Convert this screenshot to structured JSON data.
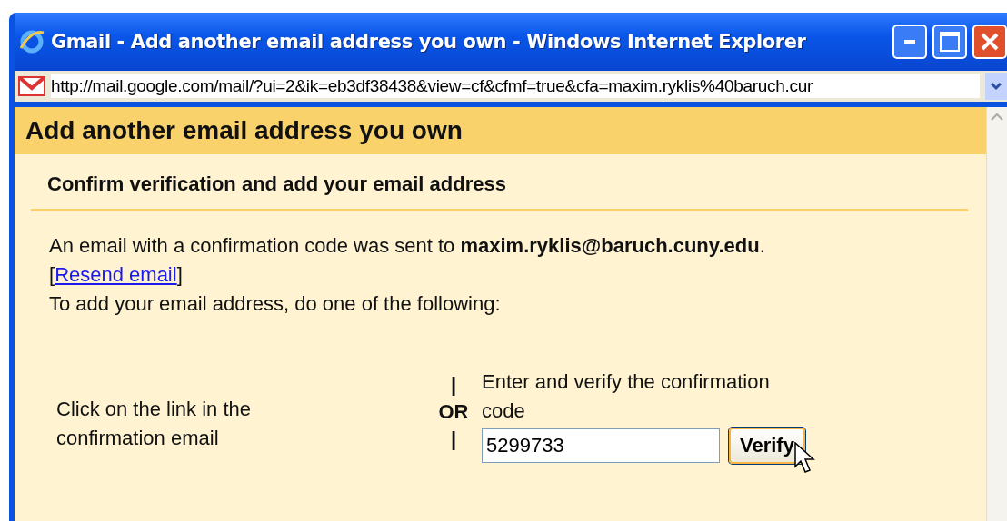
{
  "window": {
    "title": "Gmail - Add another email address you own - Windows Internet Explorer"
  },
  "address_bar": {
    "url": "http://mail.google.com/mail/?ui=2&ik=eb3df38438&view=cf&cfmf=true&cfa=maxim.ryklis%40baruch.cur"
  },
  "page": {
    "heading": "Add another email address you own",
    "section_title": "Confirm verification and add your email address",
    "message": "An email with a confirmation code was sent to **maxim.ryklis@baruch.cuny.edu**.",
    "resend_link": "Resend email",
    "bracket_open": "[",
    "bracket_close": "]",
    "instruction": "To add your email address, do one of the following:",
    "option_link": "Click on the link in the confirmation email",
    "separator_top": "|",
    "separator_or": "OR",
    "separator_bottom": "|",
    "option_code_label": "Enter and verify the confirmation code",
    "code_field": {
      "value": "5299733"
    },
    "verify_button": "Verify"
  }
}
